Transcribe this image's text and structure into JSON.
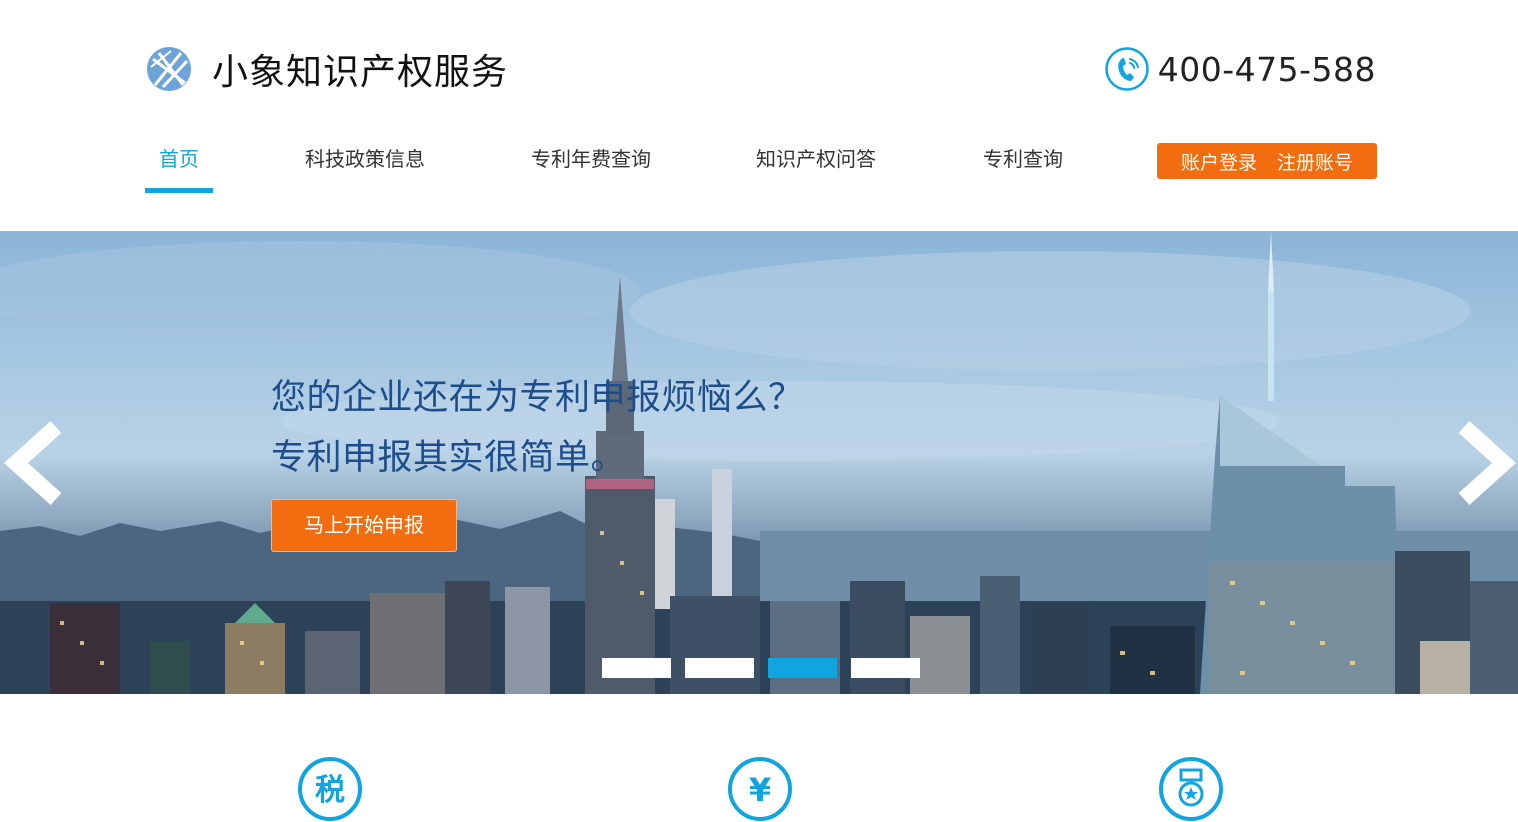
{
  "header": {
    "brand_title": "小象知识产权服务",
    "phone": "400-475-588"
  },
  "nav": {
    "items": [
      {
        "label": "首页",
        "active": true
      },
      {
        "label": "科技政策信息",
        "active": false
      },
      {
        "label": "专利年费查询",
        "active": false
      },
      {
        "label": "知识产权问答",
        "active": false
      },
      {
        "label": "专利查询",
        "active": false
      }
    ],
    "login_label": "账户登录",
    "register_label": "注册账号"
  },
  "hero": {
    "headline_line1": "您的企业还在为专利申报烦恼么？",
    "headline_line2": "专利申报其实很简单。",
    "cta_label": "马上开始申报",
    "active_slide": 3,
    "slide_count": 4
  },
  "services": {
    "icon_glyphs": [
      "税",
      "¥",
      ""
    ]
  },
  "colors": {
    "accent": "#10a5e0",
    "orange": "#f26d0f",
    "headline": "#1c4d8c"
  }
}
